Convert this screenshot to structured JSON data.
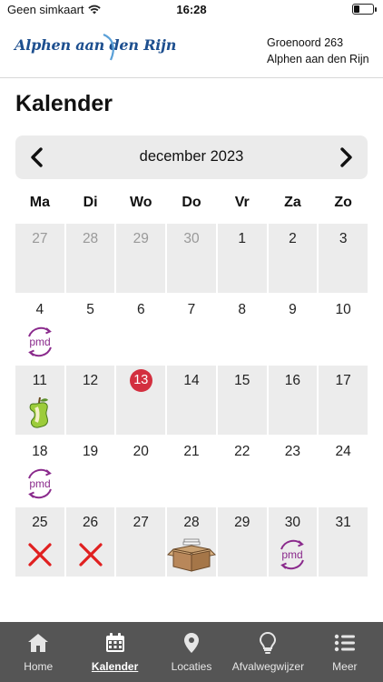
{
  "status_bar": {
    "carrier": "Geen simkaart",
    "time": "16:28"
  },
  "header": {
    "logo_text": "Alphen aan den Rijn",
    "address_line1": "Groenoord 263",
    "address_line2": "Alphen aan den Rijn"
  },
  "page_title": "Kalender",
  "month_nav": {
    "label": "december 2023"
  },
  "weekdays": [
    "Ma",
    "Di",
    "Wo",
    "Do",
    "Vr",
    "Za",
    "Zo"
  ],
  "days": [
    {
      "n": "27",
      "other": true,
      "gray": true
    },
    {
      "n": "28",
      "other": true,
      "gray": true
    },
    {
      "n": "29",
      "other": true,
      "gray": true
    },
    {
      "n": "30",
      "other": true,
      "gray": true
    },
    {
      "n": "1",
      "gray": true
    },
    {
      "n": "2",
      "gray": true
    },
    {
      "n": "3",
      "gray": true
    },
    {
      "n": "4",
      "icon": "pmd-icon"
    },
    {
      "n": "5"
    },
    {
      "n": "6"
    },
    {
      "n": "7"
    },
    {
      "n": "8"
    },
    {
      "n": "9"
    },
    {
      "n": "10"
    },
    {
      "n": "11",
      "gray": true,
      "icon": "gft-apple-icon"
    },
    {
      "n": "12",
      "gray": true
    },
    {
      "n": "13",
      "gray": true,
      "today": true
    },
    {
      "n": "14",
      "gray": true
    },
    {
      "n": "15",
      "gray": true
    },
    {
      "n": "16",
      "gray": true
    },
    {
      "n": "17",
      "gray": true
    },
    {
      "n": "18",
      "icon": "pmd-icon"
    },
    {
      "n": "19"
    },
    {
      "n": "20"
    },
    {
      "n": "21"
    },
    {
      "n": "22"
    },
    {
      "n": "23"
    },
    {
      "n": "24"
    },
    {
      "n": "25",
      "gray": true,
      "icon": "cancel-x-icon"
    },
    {
      "n": "26",
      "gray": true,
      "icon": "cancel-x-icon"
    },
    {
      "n": "27",
      "gray": true
    },
    {
      "n": "28",
      "gray": true,
      "icon": "paper-box-icon"
    },
    {
      "n": "29",
      "gray": true
    },
    {
      "n": "30",
      "gray": true,
      "icon": "pmd-icon"
    },
    {
      "n": "31",
      "gray": true
    }
  ],
  "tabbar": {
    "items": [
      {
        "label": "Home",
        "icon": "home-icon"
      },
      {
        "label": "Kalender",
        "icon": "calendar-icon",
        "active": true
      },
      {
        "label": "Locaties",
        "icon": "location-pin-icon"
      },
      {
        "label": "Afvalwegwijzer",
        "icon": "lightbulb-icon"
      },
      {
        "label": "Meer",
        "icon": "menu-list-icon"
      }
    ]
  },
  "colors": {
    "today": "#d32f3f",
    "pmd": "#8a2a8c",
    "cancel": "#e02020",
    "tabbar": "#555555",
    "logo": "#1d4f8f"
  }
}
